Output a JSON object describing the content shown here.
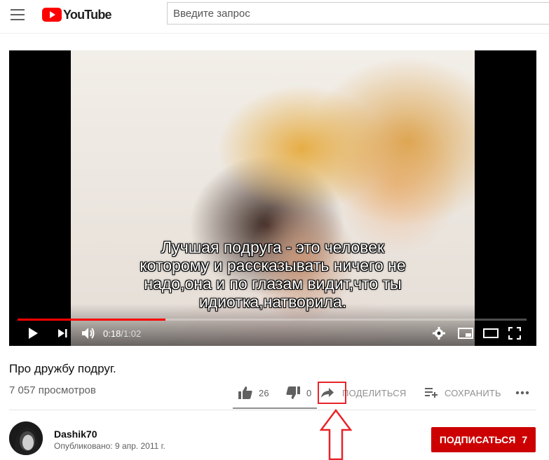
{
  "header": {
    "logo_text": "YouTube",
    "search_placeholder": "Введите запрос"
  },
  "player": {
    "caption_lines": [
      "Лучшая подруга - это человек",
      "которому и рассказывать ничего не",
      "надо,она и по глазам видит,что ты",
      "идиотка,натворила."
    ],
    "current_time": "0:18",
    "separator": " / ",
    "duration": "1:02",
    "progress_fraction": 0.29
  },
  "video": {
    "title": "Про дружбу подруг.",
    "views": "7 057 просмотров",
    "likes": "26",
    "dislikes": "0",
    "share_label": "ПОДЕЛИТЬСЯ",
    "save_label": "СОХРАНИТЬ",
    "like_ratio": 1.0
  },
  "channel": {
    "name": "Dashik70",
    "published": "Опубликовано: 9 апр. 2011 г.",
    "subscribe_label": "ПОДПИСАТЬСЯ",
    "subscriber_count": "7"
  },
  "icons": {
    "menu": "hamburger-icon",
    "play": "play-icon",
    "next": "next-icon",
    "volume": "volume-icon",
    "settings": "gear-icon",
    "miniplayer": "miniplayer-icon",
    "theater": "theater-icon",
    "fullscreen": "fullscreen-icon",
    "like": "thumbs-up-icon",
    "dislike": "thumbs-down-icon",
    "share": "share-arrow-icon",
    "save": "playlist-add-icon",
    "more": "more-horizontal-icon"
  },
  "colors": {
    "brand_red": "#ff0000",
    "subscribe_red": "#cc0000",
    "annotation_red": "#e8232a"
  }
}
